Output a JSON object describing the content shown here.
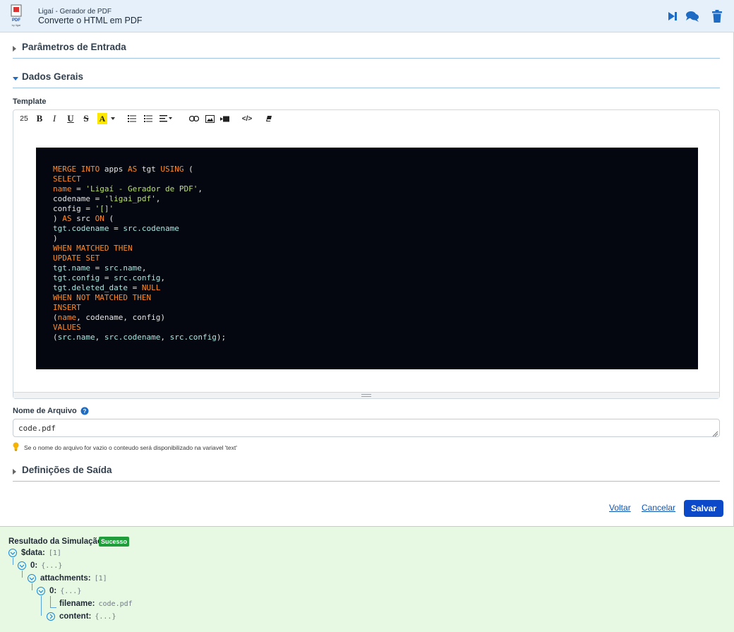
{
  "header": {
    "app_name": "Ligaí - Gerador de PDF",
    "app_subtitle": "Converte o HTML em PDF",
    "logo_text": "PDF",
    "logo_caption": "by ligaí",
    "icons": [
      "skip-forward-icon",
      "chat-icon",
      "trash-icon"
    ],
    "accent_color": "#1e6bc4"
  },
  "sections": {
    "entrada": "Parâmetros de Entrada",
    "gerais": "Dados Gerais",
    "saida": "Definições de Saída"
  },
  "template": {
    "label": "Template",
    "toolbar": {
      "font_size": "25",
      "bold": "B",
      "italic": "I",
      "underline": "U",
      "strike": "S",
      "color": "A",
      "code_view": "</>"
    },
    "code_lines": [
      [
        {
          "t": "MERGE INTO ",
          "c": "kw"
        },
        {
          "t": "apps ",
          "c": "pl"
        },
        {
          "t": "AS ",
          "c": "kw"
        },
        {
          "t": "tgt ",
          "c": "pl"
        },
        {
          "t": "USING ",
          "c": "kw"
        },
        {
          "t": "(",
          "c": "pl"
        }
      ],
      [
        {
          "t": "SELECT",
          "c": "kw"
        }
      ],
      [
        {
          "t": "name",
          "c": "kw"
        },
        {
          "t": " = ",
          "c": "pl"
        },
        {
          "t": "'Ligaí - Gerador de PDF'",
          "c": "str"
        },
        {
          "t": ",",
          "c": "pl"
        }
      ],
      [
        {
          "t": "codename",
          "c": "pl"
        },
        {
          "t": " = ",
          "c": "pl"
        },
        {
          "t": "'ligai_pdf'",
          "c": "str"
        },
        {
          "t": ",",
          "c": "pl"
        }
      ],
      [
        {
          "t": "config",
          "c": "pl"
        },
        {
          "t": " = ",
          "c": "pl"
        },
        {
          "t": "'[]'",
          "c": "str"
        }
      ],
      [
        {
          "t": ") ",
          "c": "pl"
        },
        {
          "t": "AS ",
          "c": "kw"
        },
        {
          "t": "src ",
          "c": "pl"
        },
        {
          "t": "ON ",
          "c": "kw"
        },
        {
          "t": "(",
          "c": "pl"
        }
      ],
      [
        {
          "t": "tgt.codename",
          "c": "id"
        },
        {
          "t": " = ",
          "c": "pl"
        },
        {
          "t": "src.codename",
          "c": "id"
        }
      ],
      [
        {
          "t": ")",
          "c": "pl"
        }
      ],
      [
        {
          "t": "WHEN MATCHED THEN",
          "c": "kw"
        }
      ],
      [
        {
          "t": "UPDATE SET",
          "c": "kw"
        }
      ],
      [
        {
          "t": "tgt.name",
          "c": "id"
        },
        {
          "t": " = ",
          "c": "pl"
        },
        {
          "t": "src.name",
          "c": "id"
        },
        {
          "t": ",",
          "c": "pl"
        }
      ],
      [
        {
          "t": "tgt.config",
          "c": "id"
        },
        {
          "t": " = ",
          "c": "pl"
        },
        {
          "t": "src.config",
          "c": "id"
        },
        {
          "t": ",",
          "c": "pl"
        }
      ],
      [
        {
          "t": "tgt.deleted_date",
          "c": "id"
        },
        {
          "t": " = ",
          "c": "pl"
        },
        {
          "t": "NULL",
          "c": "kw"
        }
      ],
      [
        {
          "t": "WHEN NOT MATCHED THEN",
          "c": "kw"
        }
      ],
      [
        {
          "t": "INSERT",
          "c": "kw"
        }
      ],
      [
        {
          "t": "(",
          "c": "pl"
        },
        {
          "t": "name",
          "c": "kw"
        },
        {
          "t": ", codename, config)",
          "c": "pl"
        }
      ],
      [
        {
          "t": "VALUES",
          "c": "kw"
        }
      ],
      [
        {
          "t": "(",
          "c": "pl"
        },
        {
          "t": "src.name",
          "c": "id"
        },
        {
          "t": ", ",
          "c": "pl"
        },
        {
          "t": "src.codename",
          "c": "id"
        },
        {
          "t": ", ",
          "c": "pl"
        },
        {
          "t": "src.config",
          "c": "id"
        },
        {
          "t": ");",
          "c": "pl"
        }
      ]
    ]
  },
  "filename": {
    "label": "Nome de Arquivo",
    "value": "code.pdf",
    "hint": "Se o nome do arquivo for vazio o conteudo será disponibilizado na variavel 'text'"
  },
  "actions": {
    "back": "Voltar",
    "cancel": "Cancelar",
    "save": "Salvar"
  },
  "result": {
    "title": "Resultado da Simulação:",
    "status": "Sucesso",
    "tree": {
      "data_key": "$data:",
      "data_val": "[1]",
      "item0_key": "0:",
      "item0_val": "{...}",
      "attachments_key": "attachments:",
      "attachments_val": "[1]",
      "att0_key": "0:",
      "att0_val": "{...}",
      "filename_key": "filename:",
      "filename_val": "code.pdf",
      "content_key": "content:",
      "content_val": "{...}"
    }
  }
}
